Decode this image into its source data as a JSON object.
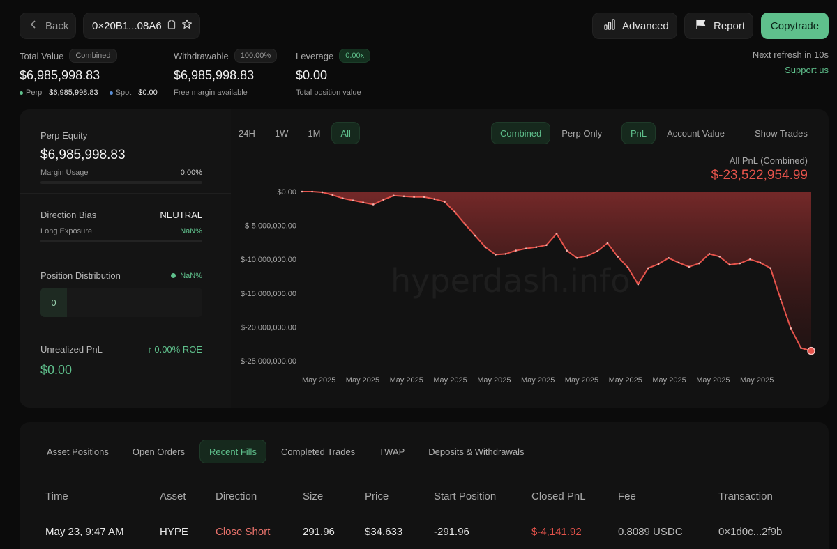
{
  "topbar": {
    "back_label": "Back",
    "address": "0×20B1...08A6",
    "advanced_label": "Advanced",
    "report_label": "Report",
    "copytrade_label": "Copytrade"
  },
  "summary": {
    "total_value": {
      "label": "Total Value",
      "pill": "Combined",
      "value": "$6,985,998.83",
      "perp_label": "Perp",
      "perp_value": "$6,985,998.83",
      "spot_label": "Spot",
      "spot_value": "$0.00"
    },
    "withdrawable": {
      "label": "Withdrawable",
      "pill": "100.00%",
      "value": "$6,985,998.83",
      "sub": "Free margin available"
    },
    "leverage": {
      "label": "Leverage",
      "pill": "0.00x",
      "value": "$0.00",
      "sub": "Total position value"
    },
    "refresh": "Next refresh in 10s",
    "support": "Support us"
  },
  "left_card": {
    "perp_equity_label": "Perp Equity",
    "perp_equity_value": "$6,985,998.83",
    "margin_usage_label": "Margin Usage",
    "margin_usage_value": "0.00%",
    "direction_bias_label": "Direction Bias",
    "direction_bias_value": "NEUTRAL",
    "long_exposure_label": "Long Exposure",
    "long_exposure_value": "NaN%",
    "position_distribution_label": "Position Distribution",
    "position_distribution_value": "NaN%",
    "position_distribution_count": "0",
    "unrealized_pnl_label": "Unrealized PnL",
    "roe": "↑ 0.00% ROE",
    "unrealized_pnl_value": "$0.00"
  },
  "chart_controls": {
    "ranges": [
      "24H",
      "1W",
      "1M",
      "All"
    ],
    "active_range": "All",
    "modes": [
      "Combined",
      "Perp Only"
    ],
    "active_mode": "Combined",
    "metrics": [
      "PnL",
      "Account Value"
    ],
    "active_metric": "PnL",
    "show_trades": "Show Trades"
  },
  "chart_data": {
    "type": "area",
    "title": "All PnL (Combined)",
    "headline_value": "$-23,522,954.99",
    "watermark": "hyperdash.info",
    "y_ticks": [
      "$0.00",
      "$-5,000,000.00",
      "$-10,000,000.00",
      "$-15,000,000.00",
      "$-20,000,000.00",
      "$-25,000,000.00"
    ],
    "x_ticks": [
      "May 2025",
      "May 2025",
      "May 2025",
      "May 2025",
      "May 2025",
      "May 2025",
      "May 2025",
      "May 2025",
      "May 2025",
      "May 2025",
      "May 2025"
    ],
    "ylim": [
      -25000000,
      0
    ],
    "series": [
      {
        "values": [
          0,
          0,
          -100000,
          -500000,
          -1000000,
          -1300000,
          -1600000,
          -1900000,
          -1200000,
          -600000,
          -700000,
          -800000,
          -800000,
          -1100000,
          -1500000,
          -3000000,
          -4800000,
          -6500000,
          -8200000,
          -9300000,
          -9200000,
          -8700000,
          -8400000,
          -8200000,
          -7900000,
          -6200000,
          -8700000,
          -9800000,
          -9500000,
          -8800000,
          -7600000,
          -9600000,
          -11200000,
          -13700000,
          -11300000,
          -10700000,
          -9800000,
          -10500000,
          -11100000,
          -10600000,
          -9200000,
          -9600000,
          -10800000,
          -10600000,
          -10000000,
          -10500000,
          -11300000,
          -15900000,
          -20200000,
          -23100000,
          -23522955
        ]
      }
    ]
  },
  "bottom": {
    "tabs": [
      "Asset Positions",
      "Open Orders",
      "Recent Fills",
      "Completed Trades",
      "TWAP",
      "Deposits & Withdrawals"
    ],
    "active_tab": "Recent Fills",
    "columns": [
      "Time",
      "Asset",
      "Direction",
      "Size",
      "Price",
      "Start Position",
      "Closed PnL",
      "Fee",
      "Transaction"
    ],
    "rows": [
      {
        "time": "May 23, 9:47 AM",
        "asset": "HYPE",
        "direction": "Close Short",
        "size": "291.96",
        "price": "$34.633",
        "start_position": "-291.96",
        "closed_pnl": "$-4,141.92",
        "fee": "0.8089 USDC",
        "transaction": "0×1d0c...2f9b"
      }
    ]
  }
}
